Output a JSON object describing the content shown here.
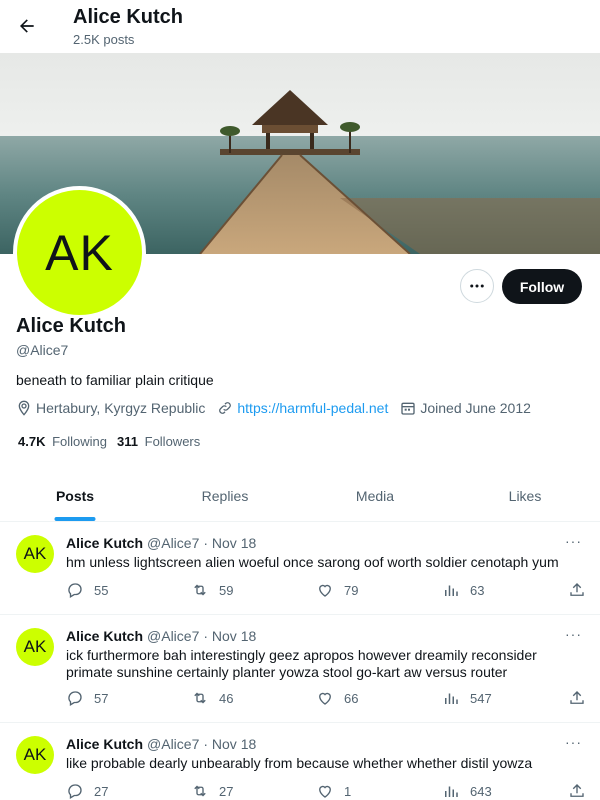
{
  "header": {
    "title": "Alice Kutch",
    "posts_count": "2.5K posts"
  },
  "profile": {
    "avatar_initials": "AK",
    "name": "Alice Kutch",
    "handle": "@Alice7",
    "bio": "beneath to familiar plain critique",
    "location": "Hertabury, Kyrgyz Republic",
    "website": "https://harmful-pedal.net",
    "joined": "Joined June 2012",
    "following_count": "4.7K",
    "following_label": "Following",
    "followers_count": "311",
    "followers_label": "Followers",
    "follow_label": "Follow",
    "more_label": "···"
  },
  "tabs": [
    {
      "label": "Posts",
      "active": true
    },
    {
      "label": "Replies",
      "active": false
    },
    {
      "label": "Media",
      "active": false
    },
    {
      "label": "Likes",
      "active": false
    }
  ],
  "posts": [
    {
      "initials": "AK",
      "name": "Alice Kutch",
      "handle": "@Alice7",
      "date": "· Nov 18",
      "text": "hm unless lightscreen alien woeful once sarong oof worth soldier cenotaph yum",
      "replies": "55",
      "reposts": "59",
      "likes": "79",
      "views": "63"
    },
    {
      "initials": "AK",
      "name": "Alice Kutch",
      "handle": "@Alice7",
      "date": "· Nov 18",
      "text": "ick furthermore bah interestingly geez apropos however dreamily reconsider primate sunshine certainly planter yowza stool go-kart aw versus router",
      "replies": "57",
      "reposts": "46",
      "likes": "66",
      "views": "547"
    },
    {
      "initials": "AK",
      "name": "Alice Kutch",
      "handle": "@Alice7",
      "date": "· Nov 18",
      "text": "like probable dearly unbearably from because whether whether distil yowza",
      "replies": "27",
      "reposts": "27",
      "likes": "1",
      "views": "643"
    }
  ],
  "colors": {
    "accent": "#1d9bf0",
    "avatar_bg": "#ccff00",
    "follow_bg": "#0f1419",
    "muted": "#536471"
  },
  "icons": [
    "back-arrow-icon",
    "location-icon",
    "link-icon",
    "calendar-icon",
    "reply-icon",
    "repost-icon",
    "like-icon",
    "views-icon",
    "share-icon",
    "more-icon"
  ]
}
